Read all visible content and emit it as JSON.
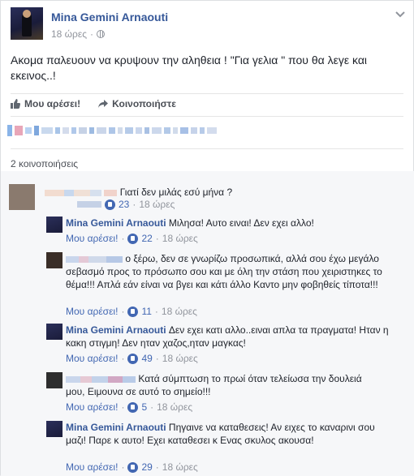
{
  "post": {
    "author": "Mina Gemini Arnaouti",
    "time": "18 ώρες",
    "text": "Ακομα παλευουν να κρυψουν την αληθεια ! \"Για γελια \" που θα λεγε και εκεινος..!",
    "like_label": "Μου αρέσει!",
    "share_label": "Κοινοποιήστε",
    "shares_count": "2 κοινοποιήσεις"
  },
  "comments": [
    {
      "author": "",
      "text": "Γιατί δεν μιλάς εσύ μήνα ?",
      "likes": "23",
      "time": "18 ώρες"
    },
    {
      "author": "Mina Gemini Arnaouti",
      "text": "Μιλησα! Αυτο ειναι! Δεν εχει αλλο!",
      "like_label": "Μου αρέσει!",
      "likes": "22",
      "time": "18 ώρες"
    },
    {
      "author": "",
      "text": "ο ξέρω, δεν σε γνωρίζω προσωπικά, αλλά σου έχω μεγάλο σεβασμό προς το πρόσωπο σου και με όλη την στάση που χειριστηκες το θέμα!!! Απλά εάν είναι να βγει και κάτι άλλο Καντο μην φοβηθείς τίποτα!!!",
      "like_label": "Μου αρέσει!",
      "likes": "11",
      "time": "18 ώρες"
    },
    {
      "author": "Mina Gemini Arnaouti",
      "text": "Δεν εχει κατι αλλο..ειναι απλα τα πραγματα! Ηταν η κακη στιγμη! Δεν ηταν χαζος,ηταν μαγκας!",
      "like_label": "Μου αρέσει!",
      "likes": "49",
      "time": "18 ώρες"
    },
    {
      "author": "",
      "text": "Κατά σύμπτωση το πρωί όταν τελείωσα την δουλειά μου, Ειμουνα σε αυτό το σημείο!!!",
      "like_label": "Μου αρέσει!",
      "likes": "5",
      "time": "18 ώρες"
    },
    {
      "author": "Mina Gemini Arnaouti",
      "text": "Πηγαινε να καταθεσεις! Αν ειχες το καναρινι σου μαζι! Παρε κ αυτο! Εχει καταθεσει κ Ενας σκυλος ακουσα!",
      "like_label": "Μου αρέσει!",
      "likes": "29",
      "time": "18 ώρες"
    }
  ],
  "colors": {
    "link": "#365899",
    "meta": "#90949c",
    "like_blue": "#4267b2"
  },
  "icons": [
    "globe-icon",
    "chevron-down-icon",
    "thumbs-up-icon",
    "share-arrow-icon",
    "like-badge-icon"
  ]
}
